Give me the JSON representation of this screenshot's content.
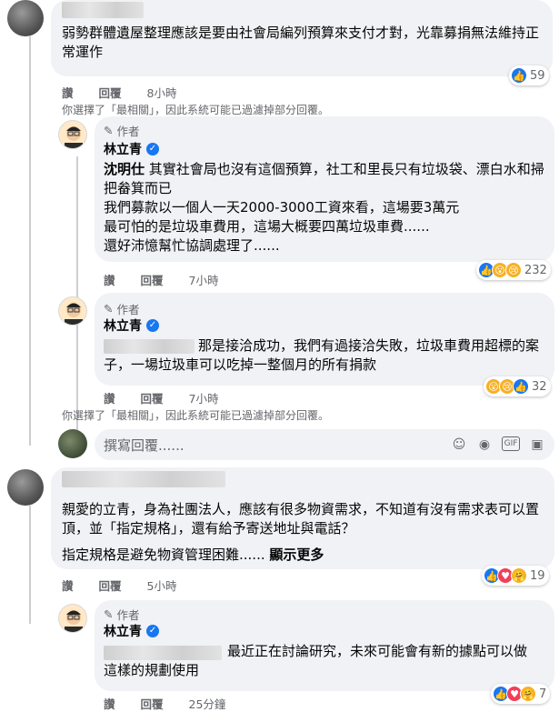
{
  "comment1": {
    "text": "弱勢群體遺屋整理應該是要由社會局編列預算來支付才對，光靠募捐無法維持正常運作",
    "actions": {
      "like": "讚",
      "reply": "回覆",
      "time": "8小時"
    },
    "reaction_count": "59",
    "reaction_icons": [
      "like-reaction-icon"
    ]
  },
  "filter_note_1": "你選擇了「最相關」，因此系統可能已過濾掉部分回覆。",
  "reply1": {
    "author_tag": "作者",
    "author_name": "林立青",
    "mention": "沈明仕",
    "line1": " 其實社會局也沒有這個預算，社工和里長只有垃圾袋、漂白水和掃把畚箕而已",
    "line2": "我們募款以一個人一天2000-3000工資來看，這場要3萬元",
    "line3": "最可怕的是垃圾車費用，這場大概要四萬垃圾車費......",
    "line4": "還好沛憶幫忙協調處理了......",
    "actions": {
      "like": "讚",
      "reply": "回覆",
      "time": "7小時"
    },
    "reaction_count": "232"
  },
  "reply2": {
    "author_tag": "作者",
    "author_name": "林立青",
    "text_after_mention": "那是接洽成功，我們有過接洽失敗，垃圾車費用超標的案子，一場垃圾車可以吃掉一整個月的所有捐款",
    "actions": {
      "like": "讚",
      "reply": "回覆",
      "time": "7小時"
    },
    "reaction_count": "32"
  },
  "filter_note_2": "你選擇了「最相關」，因此系統可能已過濾掉部分回覆。",
  "compose": {
    "placeholder": "撰寫回覆......",
    "icons": [
      "emoji-icon",
      "camera-icon",
      "gif-icon",
      "sticker-icon"
    ],
    "gif_label": "GIF"
  },
  "comment2": {
    "line1": "親愛的立青，身為社團法人，應該有很多物資需求，不知道有沒有需求表可以置頂，並「指定規格」，還有給予寄送地址與電話？",
    "line2": "指定規格是避免物資管理困難......",
    "see_more": "顯示更多",
    "actions": {
      "like": "讚",
      "reply": "回覆",
      "time": "5小時"
    },
    "reaction_count": "19"
  },
  "reply3": {
    "author_tag": "作者",
    "author_name": "林立青",
    "text_after_mention": "最近正在討論研究，未來可能會有新的據點可以做這樣的規劃使用",
    "actions": {
      "like": "讚",
      "reply": "回覆",
      "time": "25分鐘"
    },
    "reaction_count": "7"
  },
  "colors": {
    "link_blue": "#1877f2",
    "bubble": "#f0f2f5",
    "meta_gray": "#65676b"
  }
}
